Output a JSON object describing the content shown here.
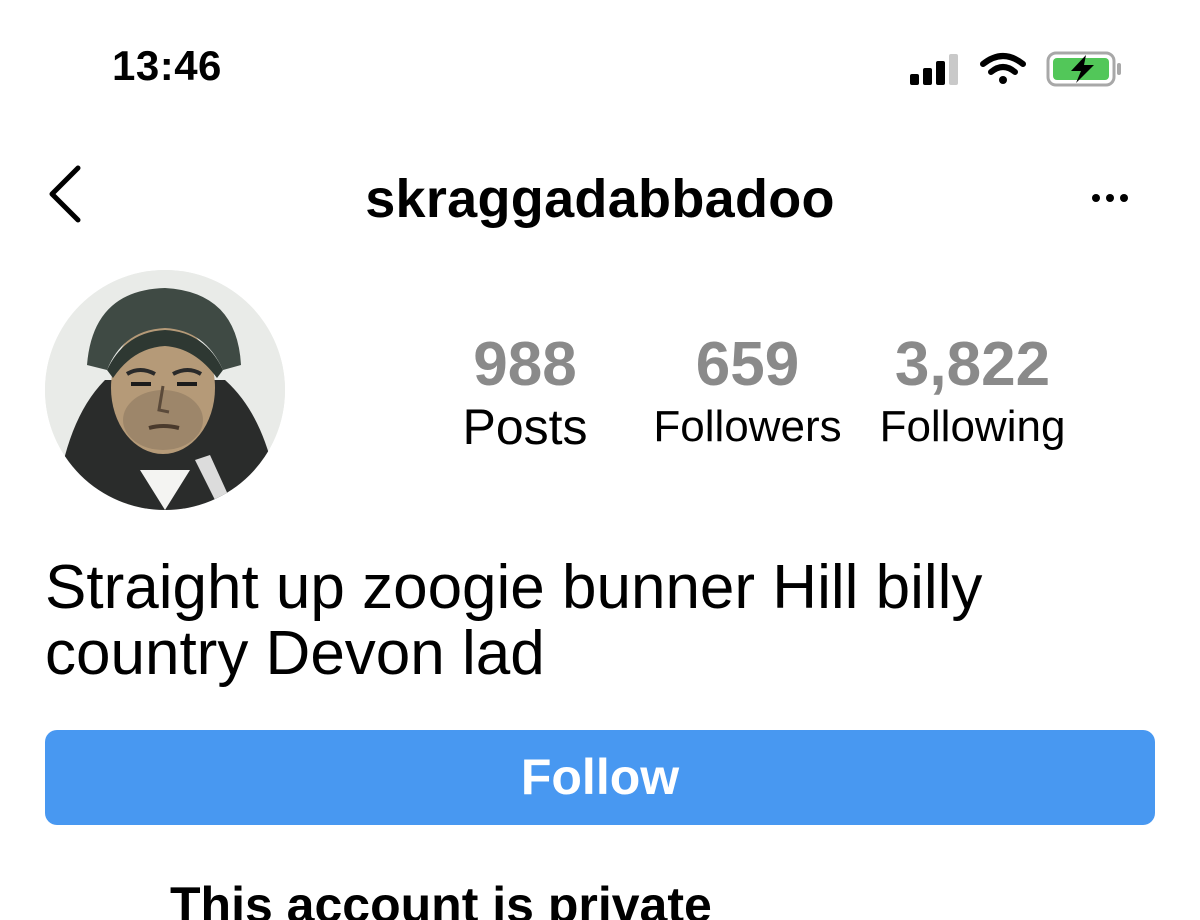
{
  "status_bar": {
    "time": "13:46",
    "icons": [
      "cellular-signal-icon",
      "wifi-icon",
      "battery-charging-icon"
    ],
    "battery_color": "#52c759"
  },
  "nav": {
    "title": "skraggadabbadoo",
    "back_icon": "chevron-left-icon",
    "more_icon": "more-horizontal-icon"
  },
  "profile": {
    "stats": {
      "posts": {
        "value": "988",
        "label": "Posts"
      },
      "followers": {
        "value": "659",
        "label": "Followers"
      },
      "following": {
        "value": "3,822",
        "label": "Following"
      }
    },
    "bio_line_1": "Straight up zoogie bunner Hill billy",
    "bio_line_2": "country Devon lad"
  },
  "follow_button": {
    "label": "Follow",
    "color": "#4898f1"
  },
  "private_notice": {
    "title": "This account is private"
  }
}
